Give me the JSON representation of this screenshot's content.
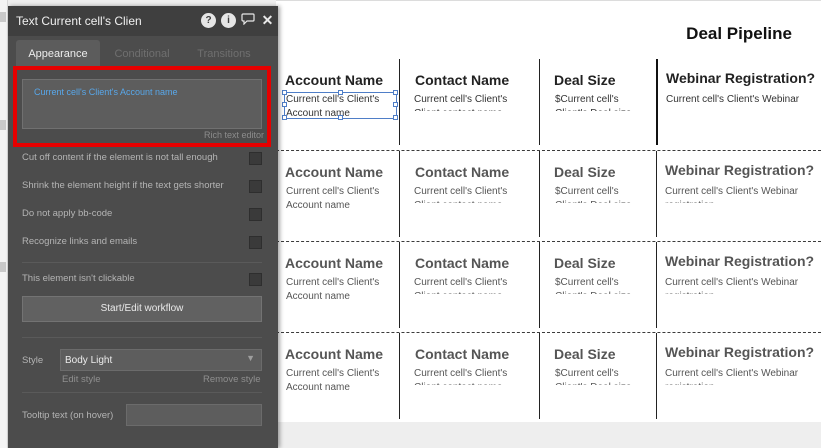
{
  "panel": {
    "title": "Text Current cell's Clien",
    "header_icons": [
      "help-icon",
      "info-icon",
      "comment-icon",
      "close-icon"
    ],
    "tabs": [
      {
        "label": "Appearance",
        "active": true
      },
      {
        "label": "Conditional",
        "active": false
      },
      {
        "label": "Transitions",
        "active": false
      }
    ],
    "rich_text": {
      "value": "Current cell's Client's Account name",
      "label": "Rich text editor"
    },
    "options": [
      {
        "label": "Cut off content if the element is not tall enough",
        "checked": false
      },
      {
        "label": "Shrink the element height if the text gets shorter",
        "checked": false
      },
      {
        "label": "Do not apply bb-code",
        "checked": false
      },
      {
        "label": "Recognize links and emails",
        "checked": false
      },
      {
        "label": "This element isn't clickable",
        "checked": false
      }
    ],
    "workflow_button": "Start/Edit workflow",
    "style": {
      "label": "Style",
      "value": "Body Light",
      "edit_link": "Edit style",
      "remove_link": "Remove style"
    },
    "tooltip": {
      "label": "Tooltip text (on hover)",
      "value": ""
    }
  },
  "canvas": {
    "page_title": "Deal Pipeline",
    "columns": [
      {
        "header": "Account Name",
        "text": "Current cell's Client's Account name"
      },
      {
        "header": "Contact Name",
        "text": "Current cell's Client's Client contact name"
      },
      {
        "header": "Deal Size",
        "text": "$Current cell's Client's Deal size"
      },
      {
        "header": "Webinar Registration?",
        "text": "Current cell's Client's Webinar registration"
      }
    ]
  },
  "colors": {
    "panel_bg": "#4c4c4c",
    "highlight_border": "#e60000",
    "rich_text_value": "#58a7ea",
    "selection": "#4f7ec7"
  }
}
